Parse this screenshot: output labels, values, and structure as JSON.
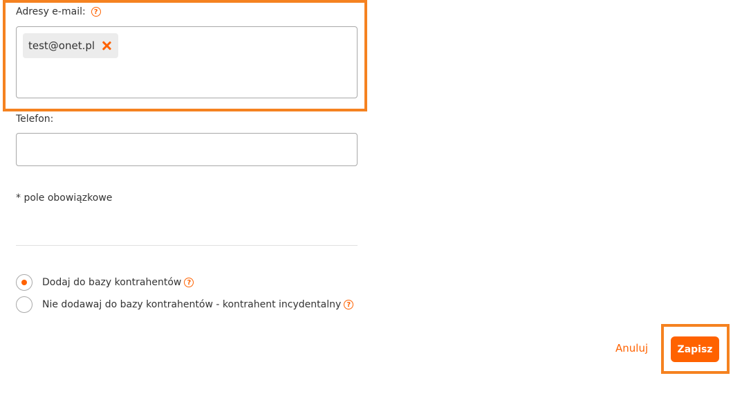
{
  "email": {
    "label": "Adresy e-mail:",
    "help_icon": "?",
    "chips": [
      {
        "value": "test@onet.pl"
      }
    ]
  },
  "phone": {
    "label": "Telefon:",
    "value": ""
  },
  "required_note": "* pole obowiązkowe",
  "contractor_options": {
    "selected_index": 0,
    "options": [
      {
        "label": "Dodaj do bazy kontrahentów",
        "help_icon": "?"
      },
      {
        "label": "Nie dodawaj do bazy kontrahentów - kontrahent incydentalny",
        "help_icon": "?"
      }
    ]
  },
  "actions": {
    "cancel_label": "Anuluj",
    "save_label": "Zapisz"
  },
  "colors": {
    "accent": "#ff6200",
    "highlight": "#f58220"
  }
}
